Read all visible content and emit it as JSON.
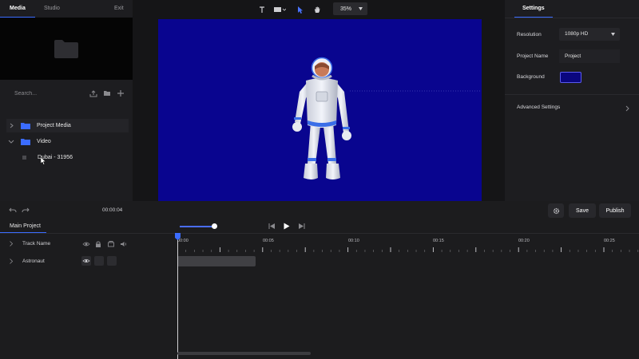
{
  "left_tabs": {
    "media": "Media",
    "studio": "Studio",
    "exit": "Exit"
  },
  "search": {
    "placeholder": "Search..."
  },
  "tree": [
    {
      "label": "Project Media",
      "folder_color": "#3b6cff"
    },
    {
      "label": "Video",
      "folder_color": "#3b6cff"
    }
  ],
  "tree_file": {
    "label": "Dubai - 31956"
  },
  "toolbar": {
    "zoom": "35%"
  },
  "stage": {
    "background": "#09058f"
  },
  "settings": {
    "tab": "Settings",
    "resolution_label": "Resolution",
    "resolution_value": "1080p HD",
    "project_name_label": "Project Name",
    "project_name_value": "Project",
    "background_label": "Background",
    "background_color": "#0a067f",
    "advanced_label": "Advanced Settings"
  },
  "action_bar": {
    "timecode": "00:00:04",
    "save": "Save",
    "publish": "Publish"
  },
  "timeline": {
    "tab": "Main Project",
    "tracks": [
      {
        "label": "Track Name"
      },
      {
        "label": "Astronaut"
      }
    ],
    "ticks": [
      "00:00",
      "00:05",
      "00:10",
      "00:15",
      "00:20",
      "00:25"
    ]
  },
  "icons": [
    "folder-icon",
    "upload-icon",
    "new-folder-icon",
    "plus-icon",
    "chevron-right-icon",
    "chevron-down-icon",
    "text-tool-icon",
    "rectangle-tool-icon",
    "pointer-tool-icon",
    "hand-tool-icon",
    "caret-down-icon",
    "undo-icon",
    "redo-icon",
    "gear-icon",
    "skip-back-icon",
    "play-icon",
    "skip-forward-icon",
    "eye-icon",
    "lock-icon",
    "layers-icon",
    "volume-icon"
  ],
  "accent_color": "#3b6cff"
}
